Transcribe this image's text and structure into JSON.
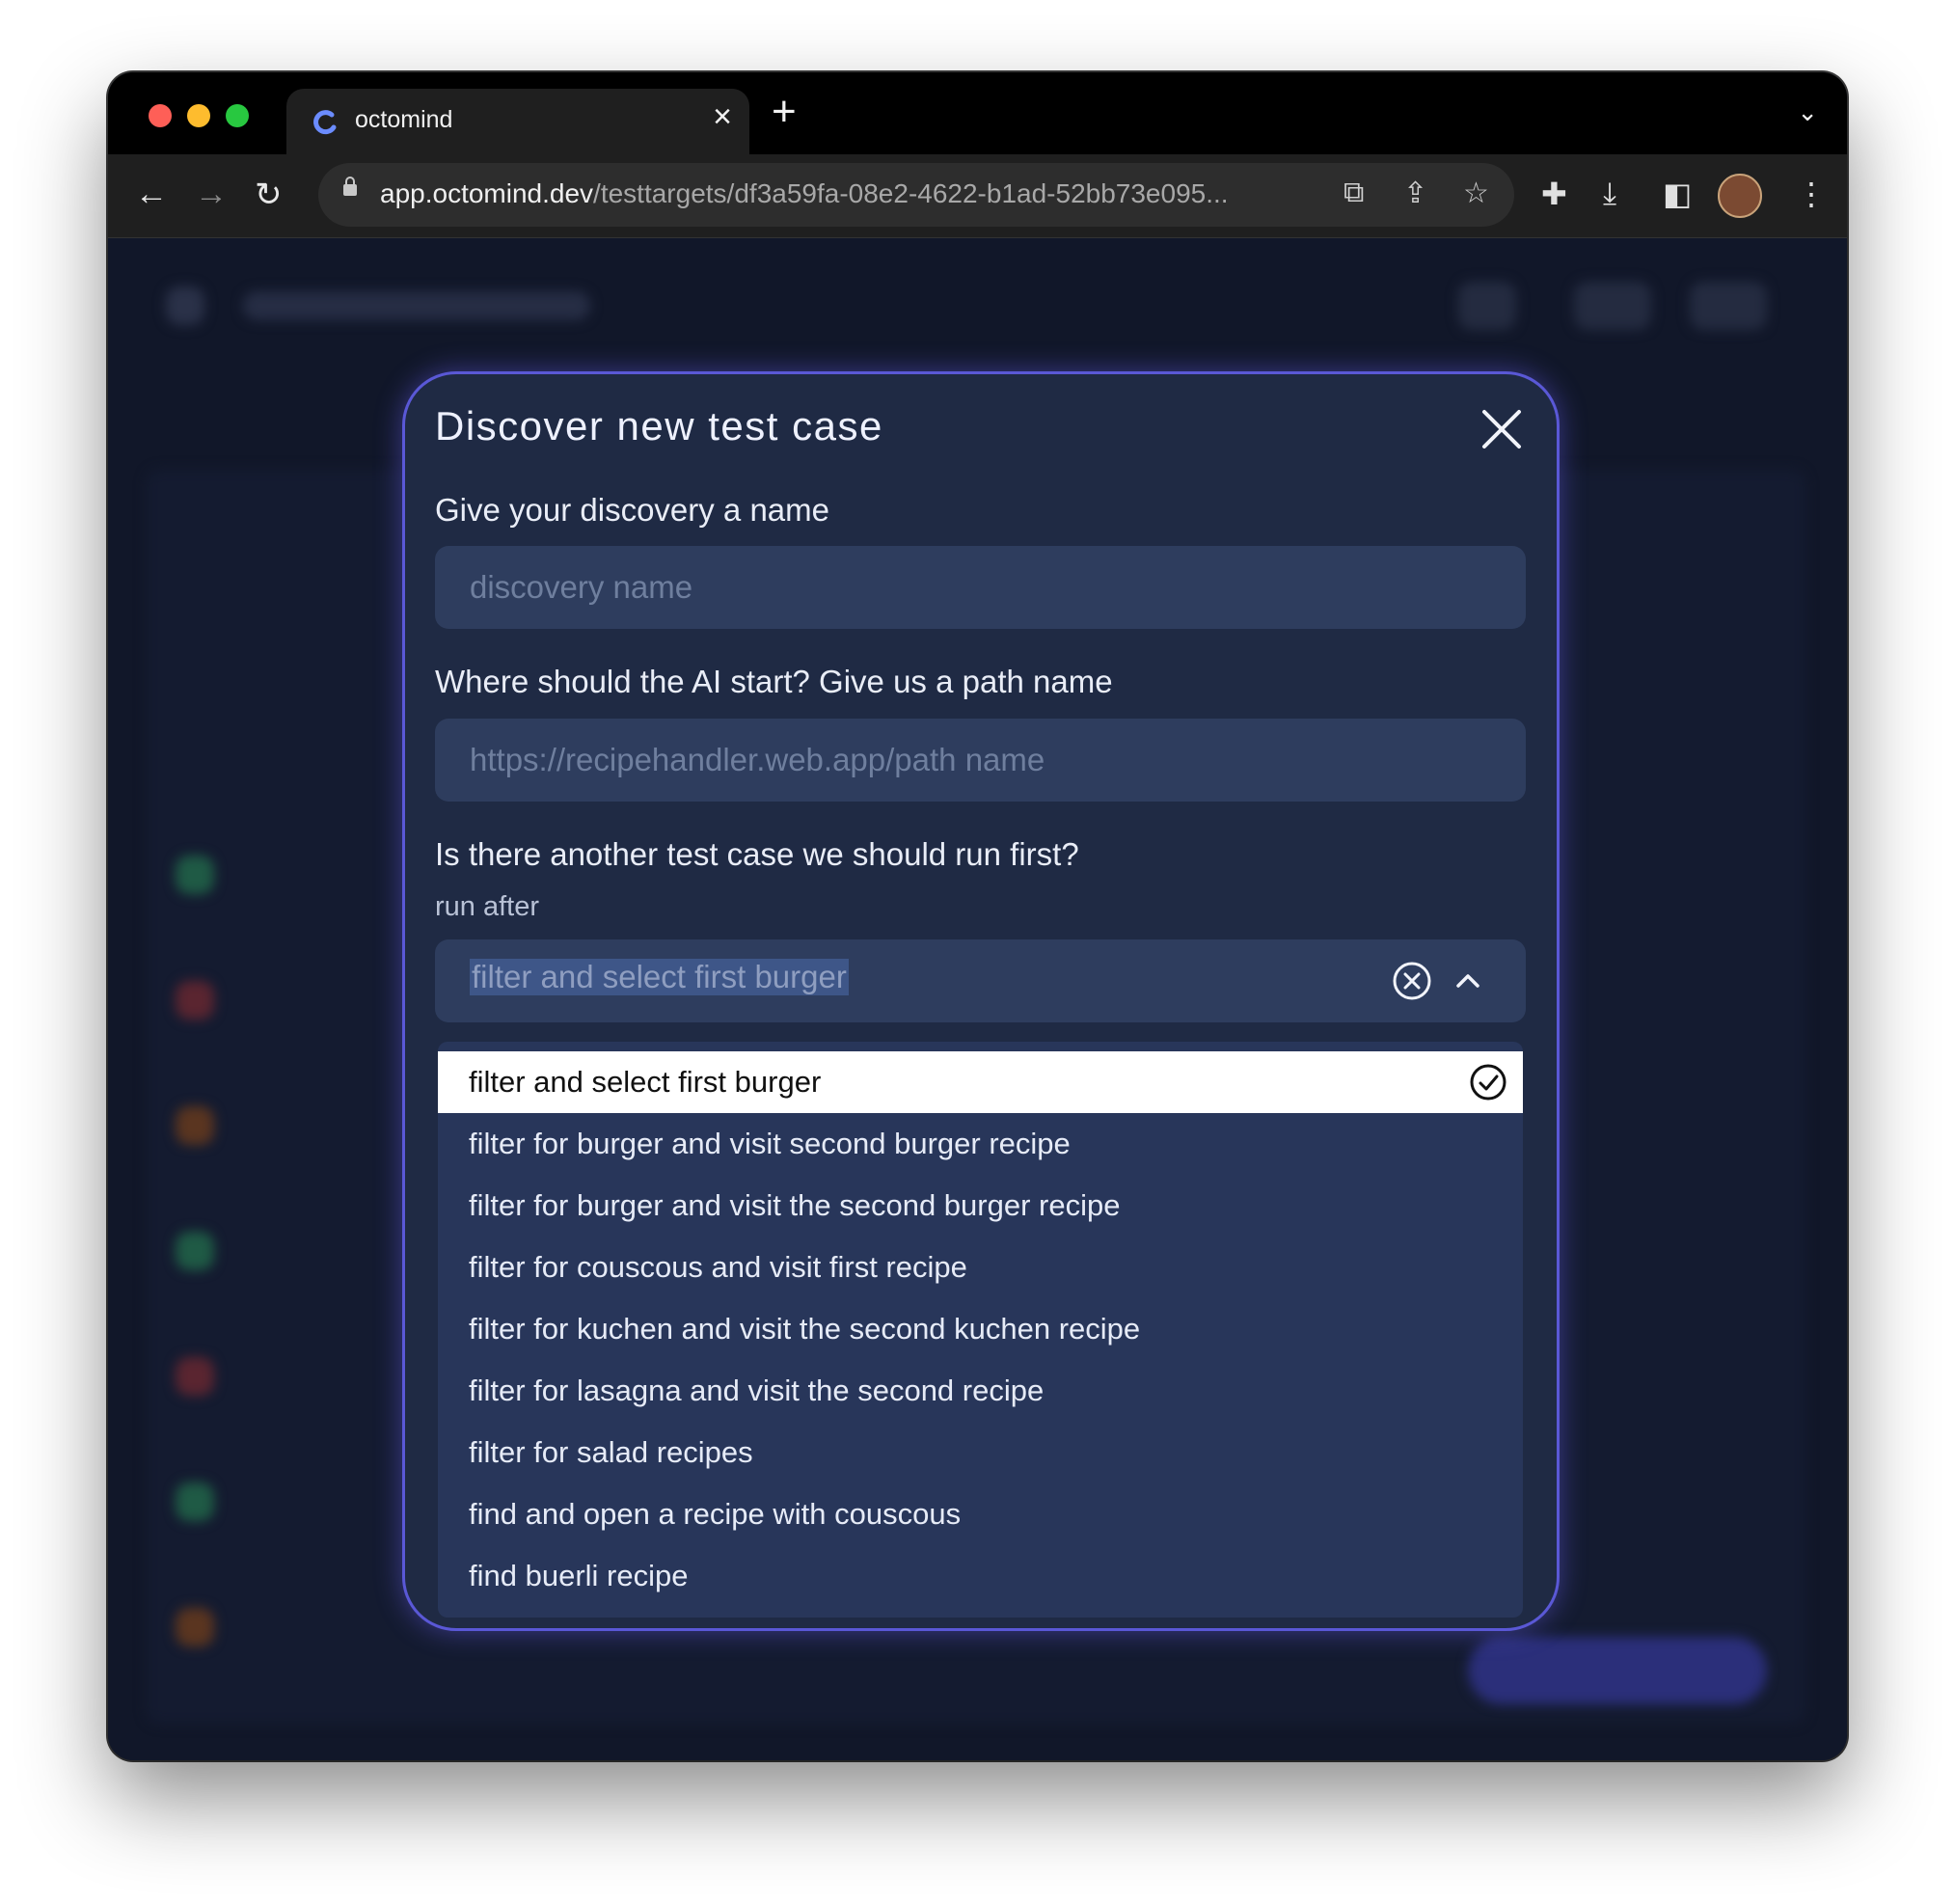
{
  "browser": {
    "tab_title": "octomind",
    "url_host": "app.octomind.dev",
    "url_path": "/testtargets/df3a59fa-08e2-4622-b1ad-52bb73e095..."
  },
  "modal": {
    "title": "Discover new test case",
    "name_label": "Give your discovery a name",
    "name_placeholder": "discovery name",
    "path_label": "Where should the AI start? Give us a path name",
    "path_placeholder": "https://recipehandler.web.app/path name",
    "run_first_label": "Is there another test case we should run first?",
    "run_after_label": "run after",
    "selected_value": "filter and select first burger",
    "options": [
      "filter and select first burger",
      "filter for burger and visit second burger recipe",
      "filter for burger and visit the second burger recipe",
      "filter for couscous and visit first recipe",
      "filter for kuchen and visit the second kuchen recipe",
      "filter for lasagna and visit the second recipe",
      "filter for salad recipes",
      "find and open a recipe with couscous",
      "find buerli recipe"
    ]
  },
  "colors": {
    "accent": "#5a58d6",
    "modal_bg": "#1f2a44",
    "input_bg": "#2e3d5e"
  }
}
